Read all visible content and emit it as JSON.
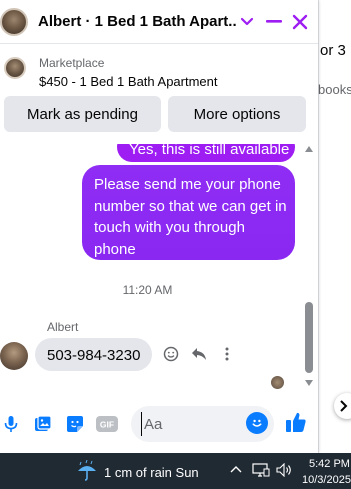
{
  "background_page": {
    "text_1": "or 3",
    "text_2": "books"
  },
  "header": {
    "title": "Albert · 1 Bed 1 Bath Apart...",
    "accent_color": "#9e1df2"
  },
  "listing": {
    "category": "Marketplace",
    "name": "$450 - 1 Bed 1 Bath Apartment",
    "mark_pending_label": "Mark as pending",
    "more_options_label": "More options"
  },
  "messages": {
    "outgoing_1": "Yes, this is still available",
    "outgoing_2": "Please send me your phone number so that we can get in touch with you through phone",
    "timestamp": "11:20 AM",
    "sender_name": "Albert",
    "incoming_1": "503-984-3230"
  },
  "composer": {
    "placeholder": "Aa",
    "icons": [
      "microphone-icon",
      "image-icon",
      "sticker-icon",
      "gif-icon",
      "emoji-icon",
      "like-icon"
    ]
  },
  "taskbar": {
    "weather": "1 cm of rain Sun",
    "time": "5:42 PM",
    "date": "10/3/2025"
  }
}
